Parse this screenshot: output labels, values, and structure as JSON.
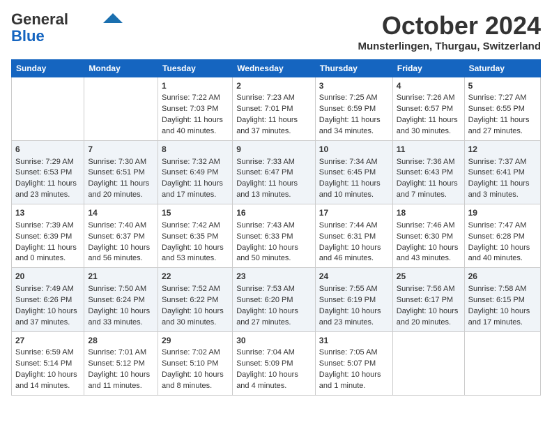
{
  "logo": {
    "general": "General",
    "blue": "Blue"
  },
  "header": {
    "title": "October 2024",
    "location": "Munsterlingen, Thurgau, Switzerland"
  },
  "weekdays": [
    "Sunday",
    "Monday",
    "Tuesday",
    "Wednesday",
    "Thursday",
    "Friday",
    "Saturday"
  ],
  "weeks": [
    [
      {
        "day": "",
        "data": ""
      },
      {
        "day": "",
        "data": ""
      },
      {
        "day": "1",
        "data": "Sunrise: 7:22 AM\nSunset: 7:03 PM\nDaylight: 11 hours and 40 minutes."
      },
      {
        "day": "2",
        "data": "Sunrise: 7:23 AM\nSunset: 7:01 PM\nDaylight: 11 hours and 37 minutes."
      },
      {
        "day": "3",
        "data": "Sunrise: 7:25 AM\nSunset: 6:59 PM\nDaylight: 11 hours and 34 minutes."
      },
      {
        "day": "4",
        "data": "Sunrise: 7:26 AM\nSunset: 6:57 PM\nDaylight: 11 hours and 30 minutes."
      },
      {
        "day": "5",
        "data": "Sunrise: 7:27 AM\nSunset: 6:55 PM\nDaylight: 11 hours and 27 minutes."
      }
    ],
    [
      {
        "day": "6",
        "data": "Sunrise: 7:29 AM\nSunset: 6:53 PM\nDaylight: 11 hours and 23 minutes."
      },
      {
        "day": "7",
        "data": "Sunrise: 7:30 AM\nSunset: 6:51 PM\nDaylight: 11 hours and 20 minutes."
      },
      {
        "day": "8",
        "data": "Sunrise: 7:32 AM\nSunset: 6:49 PM\nDaylight: 11 hours and 17 minutes."
      },
      {
        "day": "9",
        "data": "Sunrise: 7:33 AM\nSunset: 6:47 PM\nDaylight: 11 hours and 13 minutes."
      },
      {
        "day": "10",
        "data": "Sunrise: 7:34 AM\nSunset: 6:45 PM\nDaylight: 11 hours and 10 minutes."
      },
      {
        "day": "11",
        "data": "Sunrise: 7:36 AM\nSunset: 6:43 PM\nDaylight: 11 hours and 7 minutes."
      },
      {
        "day": "12",
        "data": "Sunrise: 7:37 AM\nSunset: 6:41 PM\nDaylight: 11 hours and 3 minutes."
      }
    ],
    [
      {
        "day": "13",
        "data": "Sunrise: 7:39 AM\nSunset: 6:39 PM\nDaylight: 11 hours and 0 minutes."
      },
      {
        "day": "14",
        "data": "Sunrise: 7:40 AM\nSunset: 6:37 PM\nDaylight: 10 hours and 56 minutes."
      },
      {
        "day": "15",
        "data": "Sunrise: 7:42 AM\nSunset: 6:35 PM\nDaylight: 10 hours and 53 minutes."
      },
      {
        "day": "16",
        "data": "Sunrise: 7:43 AM\nSunset: 6:33 PM\nDaylight: 10 hours and 50 minutes."
      },
      {
        "day": "17",
        "data": "Sunrise: 7:44 AM\nSunset: 6:31 PM\nDaylight: 10 hours and 46 minutes."
      },
      {
        "day": "18",
        "data": "Sunrise: 7:46 AM\nSunset: 6:30 PM\nDaylight: 10 hours and 43 minutes."
      },
      {
        "day": "19",
        "data": "Sunrise: 7:47 AM\nSunset: 6:28 PM\nDaylight: 10 hours and 40 minutes."
      }
    ],
    [
      {
        "day": "20",
        "data": "Sunrise: 7:49 AM\nSunset: 6:26 PM\nDaylight: 10 hours and 37 minutes."
      },
      {
        "day": "21",
        "data": "Sunrise: 7:50 AM\nSunset: 6:24 PM\nDaylight: 10 hours and 33 minutes."
      },
      {
        "day": "22",
        "data": "Sunrise: 7:52 AM\nSunset: 6:22 PM\nDaylight: 10 hours and 30 minutes."
      },
      {
        "day": "23",
        "data": "Sunrise: 7:53 AM\nSunset: 6:20 PM\nDaylight: 10 hours and 27 minutes."
      },
      {
        "day": "24",
        "data": "Sunrise: 7:55 AM\nSunset: 6:19 PM\nDaylight: 10 hours and 23 minutes."
      },
      {
        "day": "25",
        "data": "Sunrise: 7:56 AM\nSunset: 6:17 PM\nDaylight: 10 hours and 20 minutes."
      },
      {
        "day": "26",
        "data": "Sunrise: 7:58 AM\nSunset: 6:15 PM\nDaylight: 10 hours and 17 minutes."
      }
    ],
    [
      {
        "day": "27",
        "data": "Sunrise: 6:59 AM\nSunset: 5:14 PM\nDaylight: 10 hours and 14 minutes."
      },
      {
        "day": "28",
        "data": "Sunrise: 7:01 AM\nSunset: 5:12 PM\nDaylight: 10 hours and 11 minutes."
      },
      {
        "day": "29",
        "data": "Sunrise: 7:02 AM\nSunset: 5:10 PM\nDaylight: 10 hours and 8 minutes."
      },
      {
        "day": "30",
        "data": "Sunrise: 7:04 AM\nSunset: 5:09 PM\nDaylight: 10 hours and 4 minutes."
      },
      {
        "day": "31",
        "data": "Sunrise: 7:05 AM\nSunset: 5:07 PM\nDaylight: 10 hours and 1 minute."
      },
      {
        "day": "",
        "data": ""
      },
      {
        "day": "",
        "data": ""
      }
    ]
  ]
}
